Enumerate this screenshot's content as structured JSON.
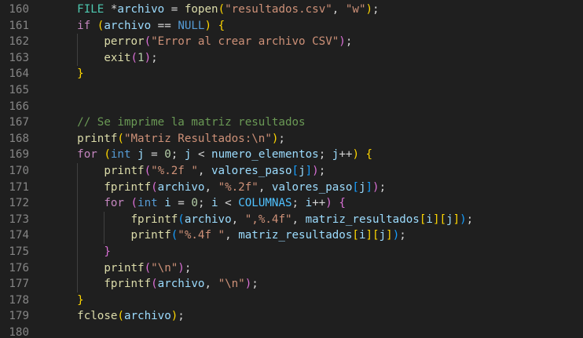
{
  "editor": {
    "lines": [
      {
        "n": "160",
        "indent": 1,
        "tokens": [
          [
            "FILE",
            "t-type"
          ],
          [
            " *",
            "t-op"
          ],
          [
            "archivo",
            "t-var"
          ],
          [
            " = ",
            "t-op"
          ],
          [
            "fopen",
            "t-fn"
          ],
          [
            "(",
            "t-b1"
          ],
          [
            "\"resultados.csv\"",
            "t-str"
          ],
          [
            ", ",
            "t-op"
          ],
          [
            "\"w\"",
            "t-str"
          ],
          [
            ")",
            "t-b1"
          ],
          [
            ";",
            "t-op"
          ]
        ]
      },
      {
        "n": "161",
        "indent": 1,
        "tokens": [
          [
            "if",
            "t-ctrl"
          ],
          [
            " ",
            "t-op"
          ],
          [
            "(",
            "t-b1"
          ],
          [
            "archivo",
            "t-var"
          ],
          [
            " == ",
            "t-op"
          ],
          [
            "NULL",
            "t-kw"
          ],
          [
            ")",
            "t-b1"
          ],
          [
            " ",
            "t-op"
          ],
          [
            "{",
            "t-b1"
          ]
        ]
      },
      {
        "n": "162",
        "indent": 2,
        "tokens": [
          [
            "perror",
            "t-fn"
          ],
          [
            "(",
            "t-b2"
          ],
          [
            "\"Error al crear archivo CSV\"",
            "t-str"
          ],
          [
            ")",
            "t-b2"
          ],
          [
            ";",
            "t-op"
          ]
        ]
      },
      {
        "n": "163",
        "indent": 2,
        "tokens": [
          [
            "exit",
            "t-fn"
          ],
          [
            "(",
            "t-b2"
          ],
          [
            "1",
            "t-num"
          ],
          [
            ")",
            "t-b2"
          ],
          [
            ";",
            "t-op"
          ]
        ]
      },
      {
        "n": "164",
        "indent": 1,
        "tokens": [
          [
            "}",
            "t-b1"
          ]
        ]
      },
      {
        "n": "165",
        "indent": 0,
        "tokens": []
      },
      {
        "n": "166",
        "indent": 0,
        "tokens": []
      },
      {
        "n": "167",
        "indent": 1,
        "tokens": [
          [
            "// Se imprime la matriz resultados",
            "t-cmt"
          ]
        ]
      },
      {
        "n": "168",
        "indent": 1,
        "tokens": [
          [
            "printf",
            "t-fn"
          ],
          [
            "(",
            "t-b1"
          ],
          [
            "\"Matriz Resultados:\\n\"",
            "t-str"
          ],
          [
            ")",
            "t-b1"
          ],
          [
            ";",
            "t-op"
          ]
        ]
      },
      {
        "n": "169",
        "indent": 1,
        "tokens": [
          [
            "for",
            "t-ctrl"
          ],
          [
            " ",
            "t-op"
          ],
          [
            "(",
            "t-b1"
          ],
          [
            "int",
            "t-kw"
          ],
          [
            " ",
            "t-op"
          ],
          [
            "j",
            "t-var"
          ],
          [
            " = ",
            "t-op"
          ],
          [
            "0",
            "t-num"
          ],
          [
            "; ",
            "t-op"
          ],
          [
            "j",
            "t-var"
          ],
          [
            " < ",
            "t-op"
          ],
          [
            "numero_elementos",
            "t-var"
          ],
          [
            "; ",
            "t-op"
          ],
          [
            "j",
            "t-var"
          ],
          [
            "++",
            "t-op"
          ],
          [
            ")",
            "t-b1"
          ],
          [
            " ",
            "t-op"
          ],
          [
            "{",
            "t-b1"
          ]
        ]
      },
      {
        "n": "170",
        "indent": 2,
        "tokens": [
          [
            "printf",
            "t-fn"
          ],
          [
            "(",
            "t-b2"
          ],
          [
            "\"%.2f \"",
            "t-str"
          ],
          [
            ", ",
            "t-op"
          ],
          [
            "valores_paso",
            "t-var"
          ],
          [
            "[",
            "t-b3"
          ],
          [
            "j",
            "t-var"
          ],
          [
            "]",
            "t-b3"
          ],
          [
            ")",
            "t-b2"
          ],
          [
            ";",
            "t-op"
          ]
        ]
      },
      {
        "n": "171",
        "indent": 2,
        "tokens": [
          [
            "fprintf",
            "t-fn"
          ],
          [
            "(",
            "t-b2"
          ],
          [
            "archivo",
            "t-var"
          ],
          [
            ", ",
            "t-op"
          ],
          [
            "\"%.2f\"",
            "t-str"
          ],
          [
            ", ",
            "t-op"
          ],
          [
            "valores_paso",
            "t-var"
          ],
          [
            "[",
            "t-b3"
          ],
          [
            "j",
            "t-var"
          ],
          [
            "]",
            "t-b3"
          ],
          [
            ")",
            "t-b2"
          ],
          [
            ";",
            "t-op"
          ]
        ]
      },
      {
        "n": "172",
        "indent": 2,
        "tokens": [
          [
            "for",
            "t-ctrl"
          ],
          [
            " ",
            "t-op"
          ],
          [
            "(",
            "t-b2"
          ],
          [
            "int",
            "t-kw"
          ],
          [
            " ",
            "t-op"
          ],
          [
            "i",
            "t-var"
          ],
          [
            " = ",
            "t-op"
          ],
          [
            "0",
            "t-num"
          ],
          [
            "; ",
            "t-op"
          ],
          [
            "i",
            "t-var"
          ],
          [
            " < ",
            "t-op"
          ],
          [
            "COLUMNAS",
            "t-const"
          ],
          [
            "; ",
            "t-op"
          ],
          [
            "i",
            "t-var"
          ],
          [
            "++",
            "t-op"
          ],
          [
            ")",
            "t-b2"
          ],
          [
            " ",
            "t-op"
          ],
          [
            "{",
            "t-b2"
          ]
        ]
      },
      {
        "n": "173",
        "indent": 3,
        "tokens": [
          [
            "fprintf",
            "t-fn"
          ],
          [
            "(",
            "t-b3"
          ],
          [
            "archivo",
            "t-var"
          ],
          [
            ", ",
            "t-op"
          ],
          [
            "\",%.4f\"",
            "t-str"
          ],
          [
            ", ",
            "t-op"
          ],
          [
            "matriz_resultados",
            "t-var"
          ],
          [
            "[",
            "t-b1"
          ],
          [
            "i",
            "t-var"
          ],
          [
            "]",
            "t-b1"
          ],
          [
            "[",
            "t-b1"
          ],
          [
            "j",
            "t-var"
          ],
          [
            "]",
            "t-b1"
          ],
          [
            ")",
            "t-b3"
          ],
          [
            ";",
            "t-op"
          ]
        ]
      },
      {
        "n": "174",
        "indent": 3,
        "tokens": [
          [
            "printf",
            "t-fn"
          ],
          [
            "(",
            "t-b3"
          ],
          [
            "\"%.4f \"",
            "t-str"
          ],
          [
            ", ",
            "t-op"
          ],
          [
            "matriz_resultados",
            "t-var"
          ],
          [
            "[",
            "t-b1"
          ],
          [
            "i",
            "t-var"
          ],
          [
            "]",
            "t-b1"
          ],
          [
            "[",
            "t-b1"
          ],
          [
            "j",
            "t-var"
          ],
          [
            "]",
            "t-b1"
          ],
          [
            ")",
            "t-b3"
          ],
          [
            ";",
            "t-op"
          ]
        ]
      },
      {
        "n": "175",
        "indent": 2,
        "tokens": [
          [
            "}",
            "t-b2"
          ]
        ]
      },
      {
        "n": "176",
        "indent": 2,
        "tokens": [
          [
            "printf",
            "t-fn"
          ],
          [
            "(",
            "t-b2"
          ],
          [
            "\"\\n\"",
            "t-str"
          ],
          [
            ")",
            "t-b2"
          ],
          [
            ";",
            "t-op"
          ]
        ]
      },
      {
        "n": "177",
        "indent": 2,
        "tokens": [
          [
            "fprintf",
            "t-fn"
          ],
          [
            "(",
            "t-b2"
          ],
          [
            "archivo",
            "t-var"
          ],
          [
            ", ",
            "t-op"
          ],
          [
            "\"\\n\"",
            "t-str"
          ],
          [
            ")",
            "t-b2"
          ],
          [
            ";",
            "t-op"
          ]
        ]
      },
      {
        "n": "178",
        "indent": 1,
        "tokens": [
          [
            "}",
            "t-b1"
          ]
        ]
      },
      {
        "n": "179",
        "indent": 1,
        "tokens": [
          [
            "fclose",
            "t-fn"
          ],
          [
            "(",
            "t-b1"
          ],
          [
            "archivo",
            "t-var"
          ],
          [
            ")",
            "t-b1"
          ],
          [
            ";",
            "t-op"
          ]
        ]
      },
      {
        "n": "180",
        "indent": 0,
        "tokens": []
      }
    ]
  }
}
